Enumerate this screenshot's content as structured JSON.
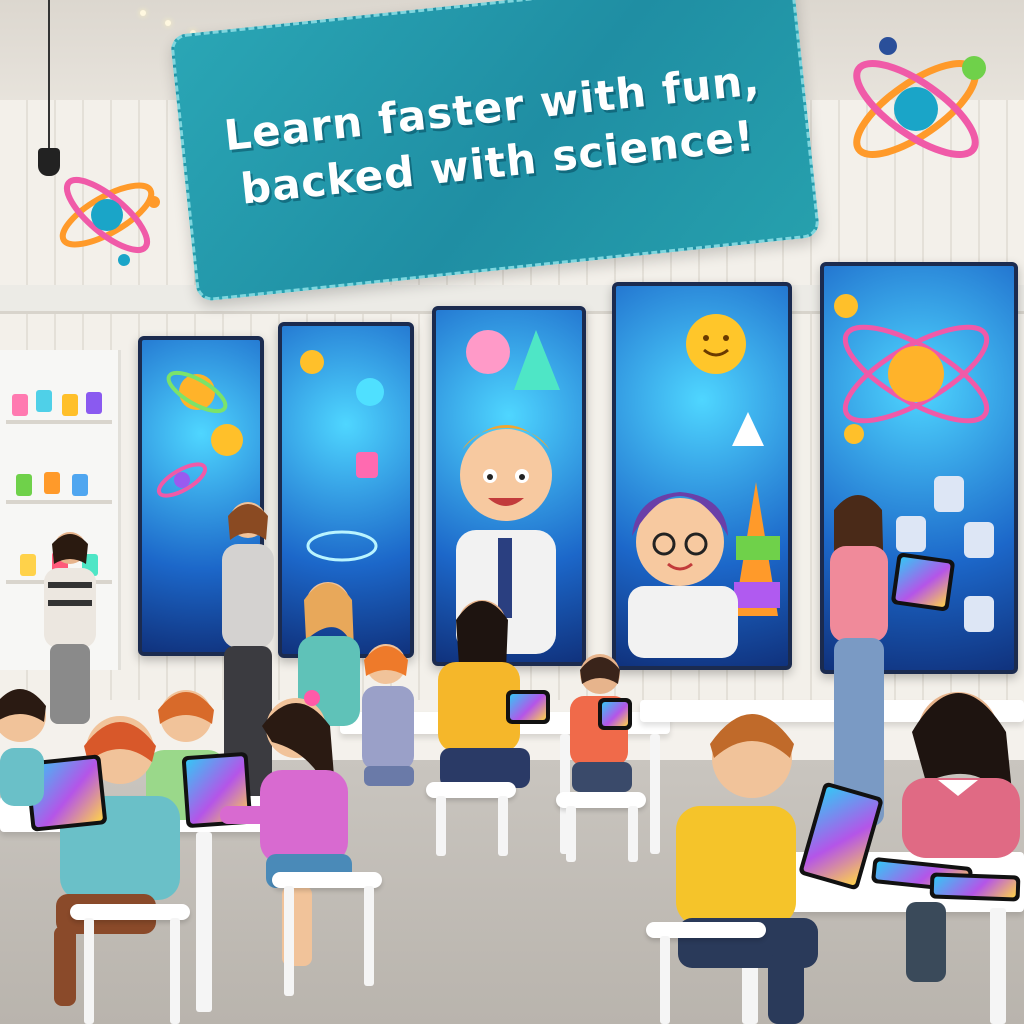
{
  "banner": {
    "line1": "Learn faster with fun,",
    "line2": "backed with science!"
  },
  "colors": {
    "banner_bg": "#1f8ea3",
    "banner_text": "#ffffff",
    "screen_glow": "#4fd6ff",
    "atom_pink": "#f05aa8",
    "atom_orange": "#ffb32a",
    "wall": "#f3f0ea",
    "floor": "#c3beb7"
  },
  "icons": [
    "atom-icon",
    "sun-icon",
    "triangle-icon",
    "tablet-icon"
  ]
}
